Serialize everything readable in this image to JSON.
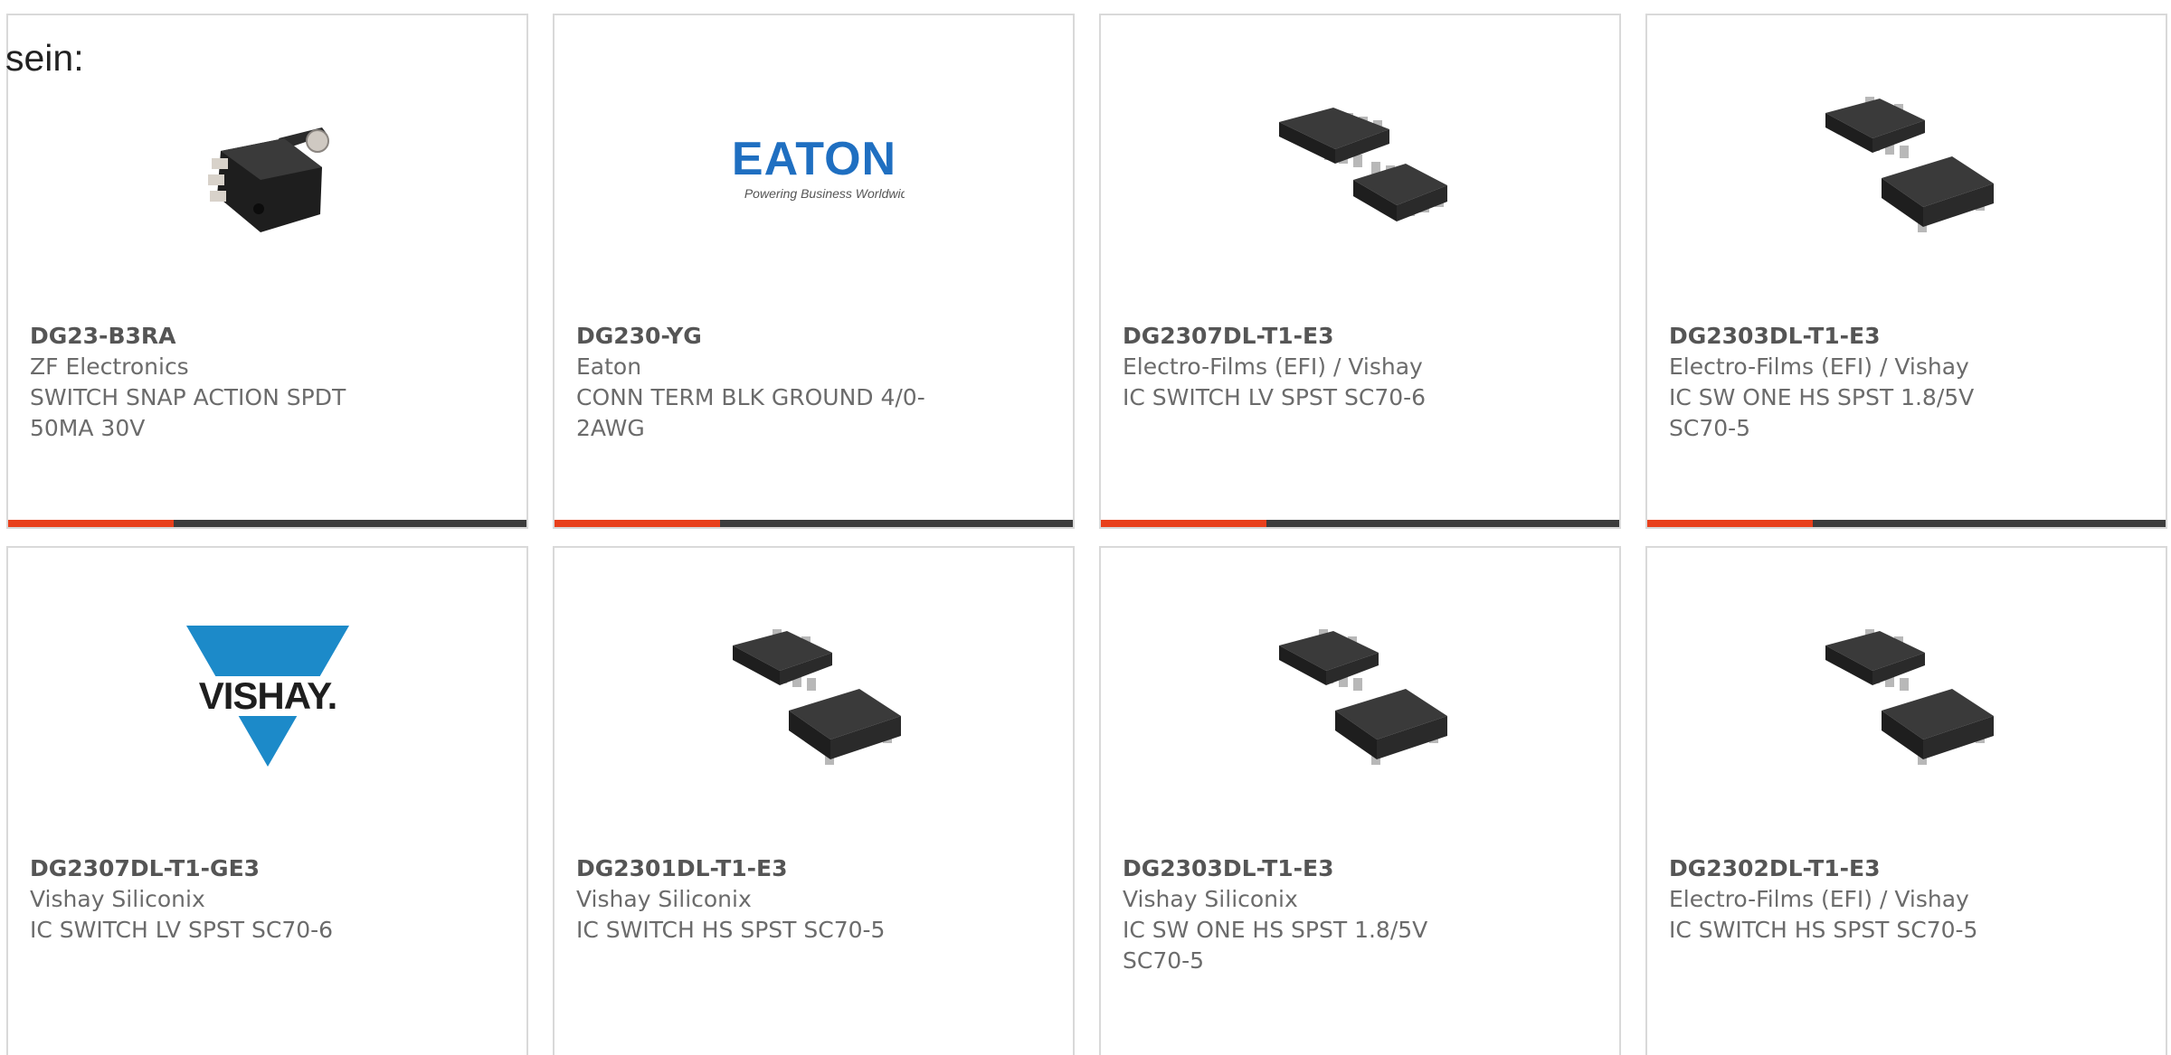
{
  "intro_text": "sein:",
  "colors": {
    "accent_orange": "#e8401c",
    "accent_dark": "#3d3d3d",
    "eaton_blue": "#1f6fc1",
    "vishay_blue": "#1c8ac9"
  },
  "cards": [
    {
      "image_icon": "micro-switch-product-photo",
      "part_number": "DG23-B3RA",
      "manufacturer": "ZF Electronics",
      "description": "SWITCH SNAP ACTION SPDT 50MA 30V"
    },
    {
      "image_icon": "eaton-logo",
      "logo_text": "EATON",
      "logo_tagline": "Powering Business Worldwide",
      "part_number": "DG230-YG",
      "manufacturer": "Eaton",
      "description": "CONN TERM BLK GROUND 4/0-2AWG"
    },
    {
      "image_icon": "sc70-6-chip-photo",
      "part_number": "DG2307DL-T1-E3",
      "manufacturer": "Electro-Films (EFI) / Vishay",
      "description": "IC SWITCH LV SPST SC70-6"
    },
    {
      "image_icon": "sc70-5-chip-photo",
      "part_number": "DG2303DL-T1-E3",
      "manufacturer": "Electro-Films (EFI) / Vishay",
      "description": "IC SW ONE HS SPST 1.8/5V SC70-5"
    },
    {
      "image_icon": "vishay-logo",
      "logo_text": "VISHAY.",
      "part_number": "DG2307DL-T1-GE3",
      "manufacturer": "Vishay Siliconix",
      "description": "IC SWITCH LV SPST SC70-6"
    },
    {
      "image_icon": "sc70-5-chip-photo",
      "part_number": "DG2301DL-T1-E3",
      "manufacturer": "Vishay Siliconix",
      "description": "IC SWITCH HS SPST SC70-5"
    },
    {
      "image_icon": "sc70-5-chip-photo",
      "part_number": "DG2303DL-T1-E3",
      "manufacturer": "Vishay Siliconix",
      "description": "IC SW ONE HS SPST 1.8/5V SC70-5"
    },
    {
      "image_icon": "sc70-5-chip-photo",
      "part_number": "DG2302DL-T1-E3",
      "manufacturer": "Electro-Films (EFI) / Vishay",
      "description": "IC SWITCH HS SPST SC70-5"
    }
  ]
}
